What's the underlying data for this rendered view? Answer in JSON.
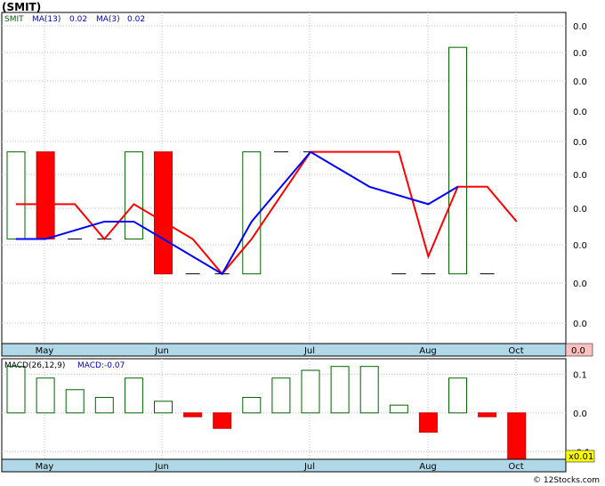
{
  "header": {
    "title": "(SMIT)"
  },
  "legend": {
    "symbol": "SMIT",
    "ma13": "MA(13)",
    "ma13_value": "0.02",
    "ma3": "MA(3)",
    "ma3_value": "0.02"
  },
  "macd_legend": {
    "label": "MACD(26,12,9)",
    "value": "MACD:-0.07"
  },
  "footer": {
    "credit": "© 12Stocks.com",
    "scale_badge": "x0.01"
  },
  "colors": {
    "up": "#006400",
    "down": "#ff0000",
    "ma13": "#ff0000",
    "ma3": "#0000ff",
    "axis_bg": "#b0d8e8",
    "highlight_label_bg": "#ffc0c0",
    "scale_badge_bg": "#ffff00"
  },
  "chart_data": [
    {
      "type": "candlestick",
      "panel": "price",
      "y_tick_labels": [
        "0.0",
        "0.0",
        "0.0",
        "0.0",
        "0.0",
        "0.0",
        "0.0",
        "0.0",
        "0.0",
        "0.0",
        "0.0"
      ],
      "highlight_y_label": "0.0",
      "x_labels": [
        "May",
        "Jun",
        "Jul",
        "Aug",
        "Oct"
      ],
      "grid": true,
      "bars": [
        {
          "open": 0.018,
          "close": 0.023,
          "high": 0.023,
          "low": 0.018,
          "dir": "up"
        },
        {
          "open": 0.023,
          "close": 0.018,
          "high": 0.023,
          "low": 0.018,
          "dir": "down"
        },
        {
          "open": 0.018,
          "close": 0.018,
          "high": 0.018,
          "low": 0.018,
          "dir": "flat"
        },
        {
          "open": 0.018,
          "close": 0.018,
          "high": 0.018,
          "low": 0.018,
          "dir": "flat"
        },
        {
          "open": 0.018,
          "close": 0.023,
          "high": 0.023,
          "low": 0.018,
          "dir": "up"
        },
        {
          "open": 0.023,
          "close": 0.016,
          "high": 0.023,
          "low": 0.016,
          "dir": "down"
        },
        {
          "open": 0.016,
          "close": 0.016,
          "high": 0.016,
          "low": 0.016,
          "dir": "flat"
        },
        {
          "open": 0.016,
          "close": 0.016,
          "high": 0.016,
          "low": 0.016,
          "dir": "flat"
        },
        {
          "open": 0.016,
          "close": 0.023,
          "high": 0.023,
          "low": 0.016,
          "dir": "up"
        },
        {
          "open": 0.023,
          "close": 0.023,
          "high": 0.023,
          "low": 0.023,
          "dir": "flat"
        },
        {
          "open": 0.023,
          "close": 0.023,
          "high": 0.023,
          "low": 0.023,
          "dir": "flat"
        },
        {
          "open": 0.023,
          "close": 0.023,
          "high": 0.023,
          "low": 0.023,
          "dir": "flat"
        },
        {
          "open": 0.023,
          "close": 0.023,
          "high": 0.023,
          "low": 0.023,
          "dir": "flat"
        },
        {
          "open": 0.016,
          "close": 0.016,
          "high": 0.016,
          "low": 0.016,
          "dir": "flat"
        },
        {
          "open": 0.016,
          "close": 0.016,
          "high": 0.016,
          "low": 0.016,
          "dir": "flat"
        },
        {
          "open": 0.016,
          "close": 0.029,
          "high": 0.029,
          "low": 0.016,
          "dir": "up"
        },
        {
          "open": 0.016,
          "close": 0.016,
          "high": 0.016,
          "low": 0.016,
          "dir": "flat"
        }
      ],
      "ma13": [
        0.02,
        0.02,
        0.02,
        0.018,
        0.02,
        0.019,
        0.018,
        0.016,
        0.018,
        0.023,
        0.023,
        0.023,
        0.023,
        0.02,
        0.017,
        0.021,
        0.021,
        0.019
      ],
      "ma13_x": [
        0,
        1,
        2,
        3,
        4,
        5,
        6,
        7,
        8,
        10,
        11,
        12,
        13,
        13.5,
        14,
        15,
        16,
        17
      ],
      "ma3": [
        0.018,
        0.018,
        0.019,
        0.019,
        0.018,
        0.016,
        0.019,
        0.023,
        0.021,
        0.02,
        0.021
      ],
      "ma3_x": [
        0,
        1,
        3,
        4,
        5,
        7,
        8,
        10,
        12,
        14,
        15
      ]
    },
    {
      "type": "bar",
      "panel": "macd",
      "title": "MACD(26,12,9)",
      "y_tick_labels": [
        "0.1",
        "0.0",
        "-0.1"
      ],
      "ylim": [
        -0.12,
        0.14
      ],
      "x_labels": [
        "May",
        "Jun",
        "Jul",
        "Aug",
        "Oct"
      ],
      "values": [
        0.12,
        0.09,
        0.06,
        0.04,
        0.09,
        0.03,
        -0.01,
        -0.04,
        0.04,
        0.09,
        0.11,
        0.12,
        0.12,
        0.02,
        -0.05,
        0.09,
        -0.01,
        -0.14
      ]
    }
  ]
}
